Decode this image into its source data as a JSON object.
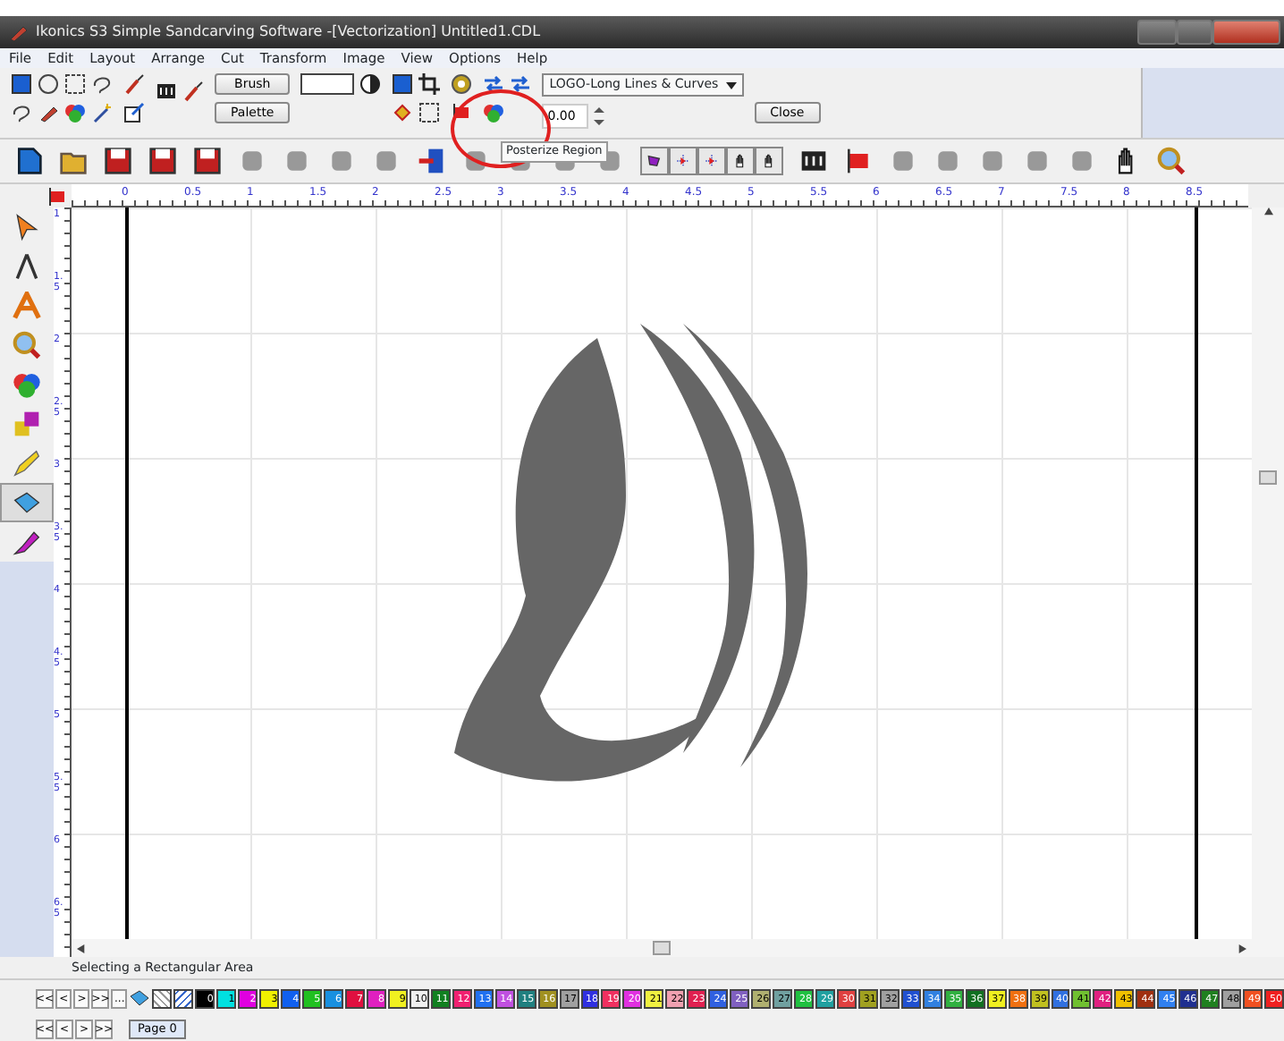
{
  "window": {
    "title": "Ikonics S3 Simple Sandcarving Software -[Vectorization] Untitled1.CDL"
  },
  "menu": [
    "File",
    "Edit",
    "Layout",
    "Arrange",
    "Cut",
    "Transform",
    "Image",
    "View",
    "Options",
    "Help"
  ],
  "toolbar": {
    "brush_button": "Brush",
    "palette_button": "Palette",
    "style_dropdown": "LOGO-Long Lines & Curves",
    "value_field": "0.00",
    "close_button": "Close",
    "tooltip": "Posterize Region"
  },
  "ruler": {
    "horizontal": [
      "0",
      "0.5",
      "1",
      "1.5",
      "2",
      "2.5",
      "3",
      "3.5",
      "4",
      "4.5",
      "5",
      "5.5",
      "6",
      "6.5",
      "7",
      "7.5",
      "8",
      "8.5"
    ],
    "vertical": [
      "1",
      "1.5",
      "2",
      "2.5",
      "3",
      "3.5",
      "4",
      "4.5",
      "5",
      "5.5",
      "6",
      "6.5"
    ]
  },
  "tools": [
    {
      "selected": false
    },
    {
      "selected": false
    },
    {
      "selected": false
    },
    {
      "selected": false
    },
    {
      "selected": false
    },
    {
      "selected": false
    },
    {
      "selected": false
    },
    {
      "selected": true
    },
    {
      "selected": false
    }
  ],
  "status_bar": "Selecting a Rectangular Area",
  "palette": {
    "nav": [
      "<<",
      "<",
      ">",
      ">>",
      "..."
    ],
    "swatches": [
      {
        "label": "0",
        "color": "#000000"
      },
      {
        "label": "1",
        "color": "#00e0e0"
      },
      {
        "label": "2",
        "color": "#e000e0"
      },
      {
        "label": "3",
        "color": "#f0f000"
      },
      {
        "label": "4",
        "color": "#1060f0"
      },
      {
        "label": "5",
        "color": "#20c020"
      },
      {
        "label": "6",
        "color": "#1890e0"
      },
      {
        "label": "7",
        "color": "#e01040"
      },
      {
        "label": "8",
        "color": "#e020c0"
      },
      {
        "label": "9",
        "color": "#f0f020"
      },
      {
        "label": "10",
        "color": "#f0f0f0"
      },
      {
        "label": "11",
        "color": "#108020"
      },
      {
        "label": "12",
        "color": "#f02070"
      },
      {
        "label": "13",
        "color": "#2070f0"
      },
      {
        "label": "14",
        "color": "#c050e0"
      },
      {
        "label": "15",
        "color": "#208080"
      },
      {
        "label": "16",
        "color": "#a09020"
      },
      {
        "label": "17",
        "color": "#a0a0a0"
      },
      {
        "label": "18",
        "color": "#3030e0"
      },
      {
        "label": "19",
        "color": "#f03060"
      },
      {
        "label": "20",
        "color": "#e030e0"
      },
      {
        "label": "21",
        "color": "#f0f040"
      },
      {
        "label": "22",
        "color": "#f0a0b0"
      },
      {
        "label": "23",
        "color": "#e02050"
      },
      {
        "label": "24",
        "color": "#3060e0"
      },
      {
        "label": "25",
        "color": "#8060c0"
      },
      {
        "label": "26",
        "color": "#b0b070"
      },
      {
        "label": "27",
        "color": "#70a0a0"
      },
      {
        "label": "28",
        "color": "#20c040"
      },
      {
        "label": "29",
        "color": "#20a0a0"
      },
      {
        "label": "30",
        "color": "#e04040"
      },
      {
        "label": "31",
        "color": "#a0a020"
      },
      {
        "label": "32",
        "color": "#a0a0a0"
      },
      {
        "label": "33",
        "color": "#2050d0"
      },
      {
        "label": "34",
        "color": "#3080e0"
      },
      {
        "label": "35",
        "color": "#30b040"
      },
      {
        "label": "36",
        "color": "#107020"
      },
      {
        "label": "37",
        "color": "#f0f020"
      },
      {
        "label": "38",
        "color": "#f07010"
      },
      {
        "label": "39",
        "color": "#c0c020"
      },
      {
        "label": "40",
        "color": "#3070e0"
      },
      {
        "label": "41",
        "color": "#70c030"
      },
      {
        "label": "42",
        "color": "#e02080"
      },
      {
        "label": "43",
        "color": "#f0c000"
      },
      {
        "label": "44",
        "color": "#a03010"
      },
      {
        "label": "45",
        "color": "#3080f0"
      },
      {
        "label": "46",
        "color": "#203090"
      },
      {
        "label": "47",
        "color": "#208020"
      },
      {
        "label": "48",
        "color": "#a0a0a0"
      },
      {
        "label": "49",
        "color": "#f05020"
      },
      {
        "label": "50",
        "color": "#f02020"
      }
    ]
  },
  "page_tabs": {
    "nav": [
      "<<",
      "<",
      ">",
      ">>"
    ],
    "pages": [
      {
        "label": "Page 0",
        "selected": true
      }
    ]
  }
}
